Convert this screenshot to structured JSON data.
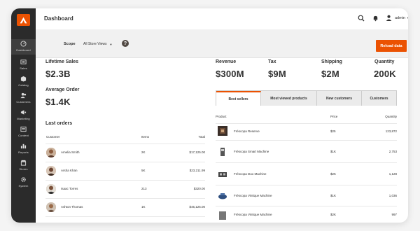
{
  "sidebar": {
    "items": [
      {
        "label": "Dashboard",
        "icon": "dashboard-icon"
      },
      {
        "label": "Sales",
        "icon": "sales-icon"
      },
      {
        "label": "Catalog",
        "icon": "catalog-icon"
      },
      {
        "label": "Customers",
        "icon": "customers-icon"
      },
      {
        "label": "Marketing",
        "icon": "marketing-icon"
      },
      {
        "label": "Content",
        "icon": "content-icon"
      },
      {
        "label": "Reports",
        "icon": "reports-icon"
      },
      {
        "label": "Stores",
        "icon": "stores-icon"
      },
      {
        "label": "System",
        "icon": "system-icon"
      }
    ]
  },
  "header": {
    "title": "Dashboard",
    "user": "admin"
  },
  "scope": {
    "label": "Scope",
    "value": "All Store Views",
    "help": "?",
    "reload": "Reload data"
  },
  "kpis": {
    "lifetime_sales": {
      "label": "Lifetime Sales",
      "value": "$2.3B"
    },
    "average_order": {
      "label": "Average Order",
      "value": "$1.4K"
    },
    "revenue": {
      "label": "Revenue",
      "value": "$300M"
    },
    "tax": {
      "label": "Tax",
      "value": "$9M"
    },
    "shipping": {
      "label": "Shipping",
      "value": "$2M"
    },
    "quantity": {
      "label": "Quantity",
      "value": "200K"
    }
  },
  "last_orders": {
    "title": "Last orders",
    "columns": [
      "Customer",
      "Items",
      "Total"
    ],
    "rows": [
      {
        "customer": "Amelia Smith",
        "items": "2K",
        "total": "$17,125.00"
      },
      {
        "customer": "Arsha Khan",
        "items": "5K",
        "total": "$23,211.99"
      },
      {
        "customer": "Isaac Torres",
        "items": "213",
        "total": "$320.00"
      },
      {
        "customer": "Ashton Thomas",
        "items": "1K",
        "total": "$45,125.00"
      }
    ]
  },
  "tabs": [
    "Best sellers",
    "Most viewed products",
    "New customers",
    "Customers"
  ],
  "products": {
    "columns": [
      "Product",
      "Price",
      "Quantity"
    ],
    "rows": [
      {
        "name": "Fréscopa Reserve",
        "price": "$25",
        "quantity": "123,872"
      },
      {
        "name": "Fréscopa Smart Machine",
        "price": "$1K",
        "quantity": "2,753"
      },
      {
        "name": "Fréscopa Duo Machine",
        "price": "$2K",
        "quantity": "1,128"
      },
      {
        "name": "Fréscopa Vintique Machine",
        "price": "$1K",
        "quantity": "1,036"
      },
      {
        "name": "Fréscopa Vintique Machine",
        "price": "$2K",
        "quantity": "997"
      }
    ]
  },
  "colors": {
    "accent": "#eb5202",
    "sidebar": "#2b2b2b"
  }
}
